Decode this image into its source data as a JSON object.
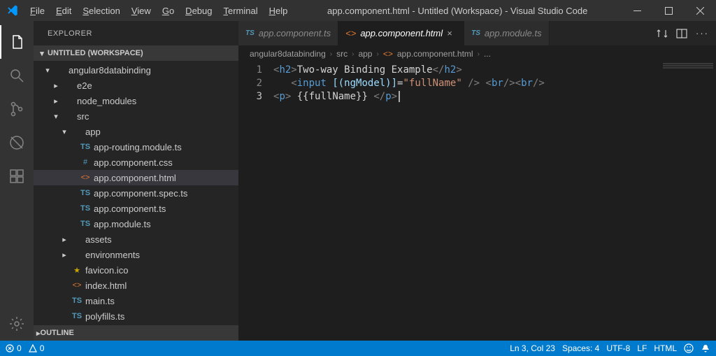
{
  "titlebar": {
    "menu": [
      "File",
      "Edit",
      "Selection",
      "View",
      "Go",
      "Debug",
      "Terminal",
      "Help"
    ],
    "title": "app.component.html - Untitled (Workspace) - Visual Studio Code"
  },
  "sidebar": {
    "header": "EXPLORER",
    "workspace": "UNTITLED (WORKSPACE)",
    "tree": [
      {
        "depth": 1,
        "tw": "▾",
        "icon": "",
        "label": "angular8databinding",
        "cls": ""
      },
      {
        "depth": 2,
        "tw": "▸",
        "icon": "",
        "label": "e2e",
        "cls": ""
      },
      {
        "depth": 2,
        "tw": "▸",
        "icon": "",
        "label": "node_modules",
        "cls": ""
      },
      {
        "depth": 2,
        "tw": "▾",
        "icon": "",
        "label": "src",
        "cls": ""
      },
      {
        "depth": 3,
        "tw": "▾",
        "icon": "",
        "label": "app",
        "cls": ""
      },
      {
        "depth": 4,
        "tw": "",
        "icon": "TS",
        "label": "app-routing.module.ts",
        "cls": "fi-ts"
      },
      {
        "depth": 4,
        "tw": "",
        "icon": "#",
        "label": "app.component.css",
        "cls": "fi-css"
      },
      {
        "depth": 4,
        "tw": "",
        "icon": "<>",
        "label": "app.component.html",
        "cls": "fi-html",
        "selected": true
      },
      {
        "depth": 4,
        "tw": "",
        "icon": "TS",
        "label": "app.component.spec.ts",
        "cls": "fi-ts"
      },
      {
        "depth": 4,
        "tw": "",
        "icon": "TS",
        "label": "app.component.ts",
        "cls": "fi-ts"
      },
      {
        "depth": 4,
        "tw": "",
        "icon": "TS",
        "label": "app.module.ts",
        "cls": "fi-ts"
      },
      {
        "depth": 3,
        "tw": "▸",
        "icon": "",
        "label": "assets",
        "cls": ""
      },
      {
        "depth": 3,
        "tw": "▸",
        "icon": "",
        "label": "environments",
        "cls": ""
      },
      {
        "depth": 3,
        "tw": "",
        "icon": "★",
        "label": "favicon.ico",
        "cls": "fi-star"
      },
      {
        "depth": 3,
        "tw": "",
        "icon": "<>",
        "label": "index.html",
        "cls": "fi-html"
      },
      {
        "depth": 3,
        "tw": "",
        "icon": "TS",
        "label": "main.ts",
        "cls": "fi-ts"
      },
      {
        "depth": 3,
        "tw": "",
        "icon": "TS",
        "label": "polyfills.ts",
        "cls": "fi-ts"
      }
    ],
    "outline": "OUTLINE"
  },
  "tabs": [
    {
      "icon": "TS",
      "icls": "fi-ts",
      "label": "app.component.ts",
      "active": false
    },
    {
      "icon": "<>",
      "icls": "fi-html",
      "label": "app.component.html",
      "active": true
    },
    {
      "icon": "TS",
      "icls": "fi-ts",
      "label": "app.module.ts",
      "active": false
    }
  ],
  "breadcrumbs": [
    "angular8databinding",
    "src",
    "app",
    "app.component.html",
    "..."
  ],
  "editor": {
    "lines": [
      [
        {
          "t": "<",
          "c": "p"
        },
        {
          "t": "h2",
          "c": "tag"
        },
        {
          "t": ">",
          "c": "p"
        },
        {
          "t": "Two-way Binding Example",
          "c": "txt"
        },
        {
          "t": "</",
          "c": "p"
        },
        {
          "t": "h2",
          "c": "tag"
        },
        {
          "t": ">",
          "c": "p"
        }
      ],
      [
        {
          "t": "   ",
          "c": "txt"
        },
        {
          "t": "<",
          "c": "p"
        },
        {
          "t": "input",
          "c": "tag"
        },
        {
          "t": " ",
          "c": "txt"
        },
        {
          "t": "[(ngModel)]",
          "c": "attr"
        },
        {
          "t": "=",
          "c": "txt"
        },
        {
          "t": "\"fullName\"",
          "c": "str"
        },
        {
          "t": " />",
          "c": "p"
        },
        {
          "t": " ",
          "c": "txt"
        },
        {
          "t": "<",
          "c": "p"
        },
        {
          "t": "br",
          "c": "tag"
        },
        {
          "t": "/>",
          "c": "p"
        },
        {
          "t": "<",
          "c": "p"
        },
        {
          "t": "br",
          "c": "tag"
        },
        {
          "t": "/>",
          "c": "p"
        }
      ],
      [
        {
          "t": "<",
          "c": "p"
        },
        {
          "t": "p",
          "c": "tag"
        },
        {
          "t": ">",
          "c": "p"
        },
        {
          "t": " {{fullName}} ",
          "c": "txt"
        },
        {
          "t": "</",
          "c": "p"
        },
        {
          "t": "p",
          "c": "tag"
        },
        {
          "t": ">",
          "c": "p"
        }
      ]
    ],
    "cursor_line": 3
  },
  "status": {
    "errors": "0",
    "warnings": "0",
    "lncol": "Ln 3, Col 23",
    "spaces": "Spaces: 4",
    "encoding": "UTF-8",
    "eol": "LF",
    "lang": "HTML"
  }
}
